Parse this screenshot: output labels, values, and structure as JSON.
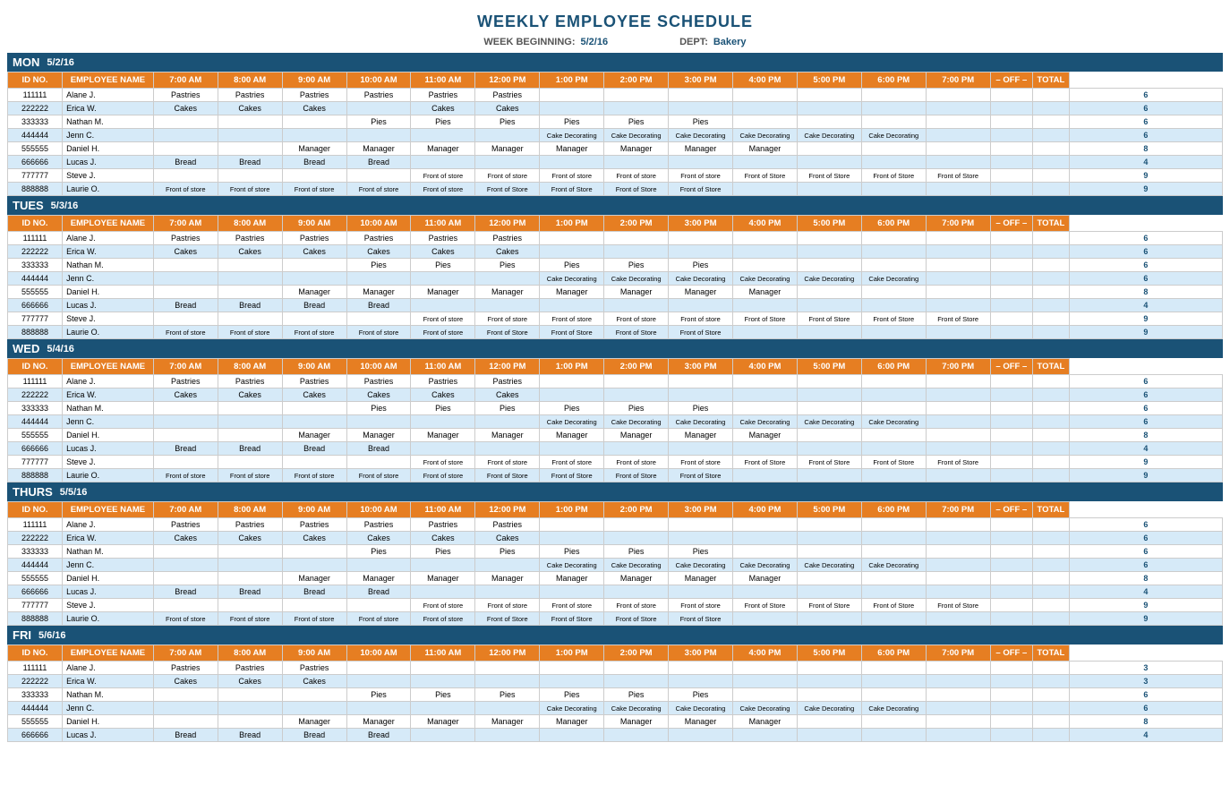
{
  "title": "WEEKLY EMPLOYEE SCHEDULE",
  "meta": {
    "week_label": "WEEK BEGINNING:",
    "week_value": "5/2/16",
    "dept_label": "DEPT:",
    "dept_value": "Bakery"
  },
  "columns": [
    "ID NO.",
    "EMPLOYEE NAME",
    "7:00 AM",
    "8:00 AM",
    "9:00 AM",
    "10:00 AM",
    "11:00 AM",
    "12:00 PM",
    "1:00 PM",
    "2:00 PM",
    "3:00 PM",
    "4:00 PM",
    "5:00 PM",
    "6:00 PM",
    "7:00 PM",
    "– OFF –",
    "TOTAL"
  ],
  "days": [
    {
      "name": "MON",
      "date": "5/2/16",
      "employees": [
        {
          "id": "111111",
          "name": "Alane J.",
          "slots": [
            "Pastries",
            "Pastries",
            "Pastries",
            "Pastries",
            "Pastries",
            "Pastries",
            "",
            "",
            "",
            "",
            "",
            "",
            "",
            "",
            "",
            "6"
          ]
        },
        {
          "id": "222222",
          "name": "Erica W.",
          "slots": [
            "Cakes",
            "Cakes",
            "Cakes",
            "",
            "Cakes",
            "Cakes",
            "",
            "",
            "",
            "",
            "",
            "",
            "",
            "",
            "",
            "6"
          ]
        },
        {
          "id": "333333",
          "name": "Nathan M.",
          "slots": [
            "",
            "",
            "",
            "Pies",
            "Pies",
            "Pies",
            "Pies",
            "Pies",
            "Pies",
            "",
            "",
            "",
            "",
            "",
            "",
            "6"
          ]
        },
        {
          "id": "444444",
          "name": "Jenn C.",
          "slots": [
            "",
            "",
            "",
            "",
            "",
            "",
            "Cake Decorating",
            "Cake Decorating",
            "Cake Decorating",
            "Cake Decorating",
            "Cake Decorating",
            "Cake Decorating",
            "",
            "",
            "",
            "6"
          ]
        },
        {
          "id": "555555",
          "name": "Daniel H.",
          "slots": [
            "",
            "",
            "Manager",
            "Manager",
            "Manager",
            "Manager",
            "Manager",
            "Manager",
            "Manager",
            "Manager",
            "",
            "",
            "",
            "",
            "",
            "8"
          ]
        },
        {
          "id": "666666",
          "name": "Lucas J.",
          "slots": [
            "Bread",
            "Bread",
            "Bread",
            "Bread",
            "",
            "",
            "",
            "",
            "",
            "",
            "",
            "",
            "",
            "",
            "",
            "4"
          ]
        },
        {
          "id": "777777",
          "name": "Steve J.",
          "slots": [
            "",
            "",
            "",
            "",
            "Front of store",
            "Front of store",
            "Front of store",
            "Front of store",
            "Front of store",
            "Front of Store",
            "Front of Store",
            "Front of Store",
            "Front of Store",
            "",
            "",
            "9"
          ]
        },
        {
          "id": "888888",
          "name": "Laurie O.",
          "slots": [
            "Front of store",
            "Front of store",
            "Front of store",
            "Front of store",
            "Front of store",
            "Front of Store",
            "Front of Store",
            "Front of Store",
            "Front of Store",
            "",
            "",
            "",
            "",
            "",
            "",
            "9"
          ]
        }
      ]
    },
    {
      "name": "TUES",
      "date": "5/3/16",
      "employees": [
        {
          "id": "111111",
          "name": "Alane J.",
          "slots": [
            "Pastries",
            "Pastries",
            "Pastries",
            "Pastries",
            "Pastries",
            "Pastries",
            "",
            "",
            "",
            "",
            "",
            "",
            "",
            "",
            "",
            "6"
          ]
        },
        {
          "id": "222222",
          "name": "Erica W.",
          "slots": [
            "Cakes",
            "Cakes",
            "Cakes",
            "Cakes",
            "Cakes",
            "Cakes",
            "",
            "",
            "",
            "",
            "",
            "",
            "",
            "",
            "",
            "6"
          ]
        },
        {
          "id": "333333",
          "name": "Nathan M.",
          "slots": [
            "",
            "",
            "",
            "Pies",
            "Pies",
            "Pies",
            "Pies",
            "Pies",
            "Pies",
            "",
            "",
            "",
            "",
            "",
            "",
            "6"
          ]
        },
        {
          "id": "444444",
          "name": "Jenn C.",
          "slots": [
            "",
            "",
            "",
            "",
            "",
            "",
            "Cake Decorating",
            "Cake Decorating",
            "Cake Decorating",
            "Cake Decorating",
            "Cake Decorating",
            "Cake Decorating",
            "",
            "",
            "",
            "6"
          ]
        },
        {
          "id": "555555",
          "name": "Daniel H.",
          "slots": [
            "",
            "",
            "Manager",
            "Manager",
            "Manager",
            "Manager",
            "Manager",
            "Manager",
            "Manager",
            "Manager",
            "",
            "",
            "",
            "",
            "",
            "8"
          ]
        },
        {
          "id": "666666",
          "name": "Lucas J.",
          "slots": [
            "Bread",
            "Bread",
            "Bread",
            "Bread",
            "",
            "",
            "",
            "",
            "",
            "",
            "",
            "",
            "",
            "",
            "",
            "4"
          ]
        },
        {
          "id": "777777",
          "name": "Steve J.",
          "slots": [
            "",
            "",
            "",
            "",
            "Front of store",
            "Front of store",
            "Front of store",
            "Front of store",
            "Front of store",
            "Front of Store",
            "Front of Store",
            "Front of Store",
            "Front of Store",
            "",
            "",
            "9"
          ]
        },
        {
          "id": "888888",
          "name": "Laurie O.",
          "slots": [
            "Front of store",
            "Front of store",
            "Front of store",
            "Front of store",
            "Front of store",
            "Front of Store",
            "Front of Store",
            "Front of Store",
            "Front of Store",
            "",
            "",
            "",
            "",
            "",
            "",
            "9"
          ]
        }
      ]
    },
    {
      "name": "WED",
      "date": "5/4/16",
      "employees": [
        {
          "id": "111111",
          "name": "Alane J.",
          "slots": [
            "Pastries",
            "Pastries",
            "Pastries",
            "Pastries",
            "Pastries",
            "Pastries",
            "",
            "",
            "",
            "",
            "",
            "",
            "",
            "",
            "",
            "6"
          ]
        },
        {
          "id": "222222",
          "name": "Erica W.",
          "slots": [
            "Cakes",
            "Cakes",
            "Cakes",
            "Cakes",
            "Cakes",
            "Cakes",
            "",
            "",
            "",
            "",
            "",
            "",
            "",
            "",
            "",
            "6"
          ]
        },
        {
          "id": "333333",
          "name": "Nathan M.",
          "slots": [
            "",
            "",
            "",
            "Pies",
            "Pies",
            "Pies",
            "Pies",
            "Pies",
            "Pies",
            "",
            "",
            "",
            "",
            "",
            "",
            "6"
          ]
        },
        {
          "id": "444444",
          "name": "Jenn C.",
          "slots": [
            "",
            "",
            "",
            "",
            "",
            "",
            "Cake Decorating",
            "Cake Decorating",
            "Cake Decorating",
            "Cake Decorating",
            "Cake Decorating",
            "Cake Decorating",
            "",
            "",
            "",
            "6"
          ]
        },
        {
          "id": "555555",
          "name": "Daniel H.",
          "slots": [
            "",
            "",
            "Manager",
            "Manager",
            "Manager",
            "Manager",
            "Manager",
            "Manager",
            "Manager",
            "Manager",
            "",
            "",
            "",
            "",
            "",
            "8"
          ]
        },
        {
          "id": "666666",
          "name": "Lucas J.",
          "slots": [
            "Bread",
            "Bread",
            "Bread",
            "Bread",
            "",
            "",
            "",
            "",
            "",
            "",
            "",
            "",
            "",
            "",
            "",
            "4"
          ]
        },
        {
          "id": "777777",
          "name": "Steve J.",
          "slots": [
            "",
            "",
            "",
            "",
            "Front of store",
            "Front of store",
            "Front of store",
            "Front of store",
            "Front of store",
            "Front of Store",
            "Front of Store",
            "Front of Store",
            "Front of Store",
            "",
            "",
            "9"
          ]
        },
        {
          "id": "888888",
          "name": "Laurie O.",
          "slots": [
            "Front of store",
            "Front of store",
            "Front of store",
            "Front of store",
            "Front of store",
            "Front of Store",
            "Front of Store",
            "Front of Store",
            "Front of Store",
            "",
            "",
            "",
            "",
            "",
            "",
            "9"
          ]
        }
      ]
    },
    {
      "name": "THURS",
      "date": "5/5/16",
      "employees": [
        {
          "id": "111111",
          "name": "Alane J.",
          "slots": [
            "Pastries",
            "Pastries",
            "Pastries",
            "Pastries",
            "Pastries",
            "Pastries",
            "",
            "",
            "",
            "",
            "",
            "",
            "",
            "",
            "",
            "6"
          ]
        },
        {
          "id": "222222",
          "name": "Erica W.",
          "slots": [
            "Cakes",
            "Cakes",
            "Cakes",
            "Cakes",
            "Cakes",
            "Cakes",
            "",
            "",
            "",
            "",
            "",
            "",
            "",
            "",
            "",
            "6"
          ]
        },
        {
          "id": "333333",
          "name": "Nathan M.",
          "slots": [
            "",
            "",
            "",
            "Pies",
            "Pies",
            "Pies",
            "Pies",
            "Pies",
            "Pies",
            "",
            "",
            "",
            "",
            "",
            "",
            "6"
          ]
        },
        {
          "id": "444444",
          "name": "Jenn C.",
          "slots": [
            "",
            "",
            "",
            "",
            "",
            "",
            "Cake Decorating",
            "Cake Decorating",
            "Cake Decorating",
            "Cake Decorating",
            "Cake Decorating",
            "Cake Decorating",
            "",
            "",
            "",
            "6"
          ]
        },
        {
          "id": "555555",
          "name": "Daniel H.",
          "slots": [
            "",
            "",
            "Manager",
            "Manager",
            "Manager",
            "Manager",
            "Manager",
            "Manager",
            "Manager",
            "Manager",
            "",
            "",
            "",
            "",
            "",
            "8"
          ]
        },
        {
          "id": "666666",
          "name": "Lucas J.",
          "slots": [
            "Bread",
            "Bread",
            "Bread",
            "Bread",
            "",
            "",
            "",
            "",
            "",
            "",
            "",
            "",
            "",
            "",
            "",
            "4"
          ]
        },
        {
          "id": "777777",
          "name": "Steve J.",
          "slots": [
            "",
            "",
            "",
            "",
            "Front of store",
            "Front of store",
            "Front of store",
            "Front of store",
            "Front of store",
            "Front of Store",
            "Front of Store",
            "Front of Store",
            "Front of Store",
            "",
            "",
            "9"
          ]
        },
        {
          "id": "888888",
          "name": "Laurie O.",
          "slots": [
            "Front of store",
            "Front of store",
            "Front of store",
            "Front of store",
            "Front of store",
            "Front of Store",
            "Front of Store",
            "Front of Store",
            "Front of Store",
            "",
            "",
            "",
            "",
            "",
            "",
            "9"
          ]
        }
      ]
    },
    {
      "name": "FRI",
      "date": "5/6/16",
      "employees": [
        {
          "id": "111111",
          "name": "Alane J.",
          "slots": [
            "Pastries",
            "Pastries",
            "Pastries",
            "",
            "",
            "",
            "",
            "",
            "",
            "",
            "",
            "",
            "",
            "",
            "",
            "3"
          ]
        },
        {
          "id": "222222",
          "name": "Erica W.",
          "slots": [
            "Cakes",
            "Cakes",
            "Cakes",
            "",
            "",
            "",
            "",
            "",
            "",
            "",
            "",
            "",
            "",
            "",
            "",
            "3"
          ]
        },
        {
          "id": "333333",
          "name": "Nathan M.",
          "slots": [
            "",
            "",
            "",
            "Pies",
            "Pies",
            "Pies",
            "Pies",
            "Pies",
            "Pies",
            "",
            "",
            "",
            "",
            "",
            "",
            "6"
          ]
        },
        {
          "id": "444444",
          "name": "Jenn C.",
          "slots": [
            "",
            "",
            "",
            "",
            "",
            "",
            "Cake Decorating",
            "Cake Decorating",
            "Cake Decorating",
            "Cake Decorating",
            "Cake Decorating",
            "Cake Decorating",
            "",
            "",
            "",
            "6"
          ]
        },
        {
          "id": "555555",
          "name": "Daniel H.",
          "slots": [
            "",
            "",
            "Manager",
            "Manager",
            "Manager",
            "Manager",
            "Manager",
            "Manager",
            "Manager",
            "Manager",
            "",
            "",
            "",
            "",
            "",
            "8"
          ]
        },
        {
          "id": "666666",
          "name": "Lucas J.",
          "slots": [
            "Bread",
            "Bread",
            "Bread",
            "Bread",
            "",
            "",
            "",
            "",
            "",
            "",
            "",
            "",
            "",
            "",
            "",
            "4"
          ]
        }
      ]
    }
  ]
}
